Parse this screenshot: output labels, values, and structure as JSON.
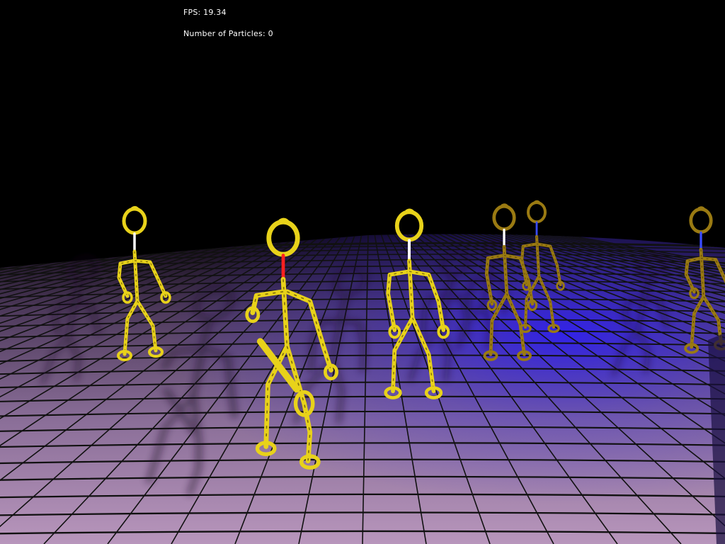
{
  "hud": {
    "fps_label": "FPS:",
    "fps_value": "19.34",
    "particles_label": "Number of Particles:",
    "particles_value": "0"
  },
  "scene": {
    "figure_color": "#e8d21a",
    "figure_dim_color": "#9a7a12",
    "neck_colors": [
      "#ffffff",
      "#ff2020",
      "#ffffff",
      "#ffffff",
      "#3a4cff",
      "#3a4cff"
    ],
    "floor_near_color": "#c2a0c4",
    "floor_far_color": "#1a0a24",
    "light_color": "#3c2cff",
    "grid_color": "#111111"
  }
}
